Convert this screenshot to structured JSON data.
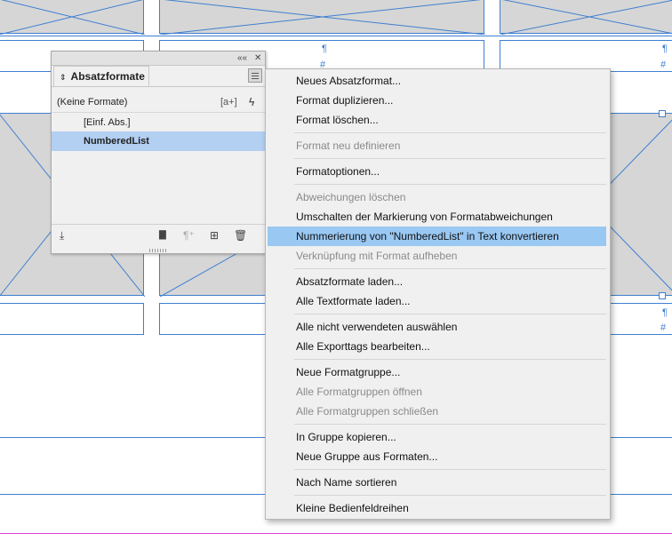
{
  "panel": {
    "tab_title": "Absatzformate",
    "tab_arrows": "⇕",
    "collapse_icon": "««",
    "close_icon": "✕",
    "current_format": "(Keine Formate)",
    "styles": [
      "[Einf. Abs.]",
      "NumberedList"
    ],
    "selected_style": "NumberedList",
    "header_icons": {
      "new_override": "[a+]",
      "clear": "ϟ"
    },
    "footer_icons": {
      "load": "⤓",
      "folder": "▇",
      "pilcrow_clear": "¶⁺",
      "new_style": "⊞",
      "delete": "🗑"
    }
  },
  "document": {
    "pilcrow": "¶",
    "hash": "#"
  },
  "menu": {
    "items": [
      {
        "label": "Neues Absatzformat...",
        "enabled": true
      },
      {
        "label": "Format duplizieren...",
        "enabled": true
      },
      {
        "label": "Format löschen...",
        "enabled": true
      },
      {
        "label": "Format neu definieren",
        "enabled": false
      },
      {
        "label": "Formatoptionen...",
        "enabled": true
      },
      {
        "label": "Abweichungen löschen",
        "enabled": false
      },
      {
        "label": "Umschalten der Markierung von Formatabweichungen",
        "enabled": true
      },
      {
        "label": "Nummerierung von \"NumberedList\" in Text konvertieren",
        "enabled": true,
        "highlighted": true
      },
      {
        "label": "Verknüpfung mit Format aufheben",
        "enabled": false
      },
      {
        "label": "Absatzformate laden...",
        "enabled": true
      },
      {
        "label": "Alle Textformate laden...",
        "enabled": true
      },
      {
        "label": "Alle nicht verwendeten auswählen",
        "enabled": true
      },
      {
        "label": "Alle Exporttags bearbeiten...",
        "enabled": true
      },
      {
        "label": "Neue Formatgruppe...",
        "enabled": true
      },
      {
        "label": "Alle Formatgruppen öffnen",
        "enabled": false
      },
      {
        "label": "Alle Formatgruppen schließen",
        "enabled": false
      },
      {
        "label": "In Gruppe kopieren...",
        "enabled": true
      },
      {
        "label": "Neue Gruppe aus Formaten...",
        "enabled": true
      },
      {
        "label": "Nach Name sortieren",
        "enabled": true
      },
      {
        "label": "Kleine Bedienfeldreihen",
        "enabled": true
      }
    ]
  },
  "colors": {
    "frame_blue": "#3f7fd0",
    "guide_magenta": "#e23ee6",
    "highlight": "#99c8f3",
    "selected_row": "#b3cff2"
  }
}
